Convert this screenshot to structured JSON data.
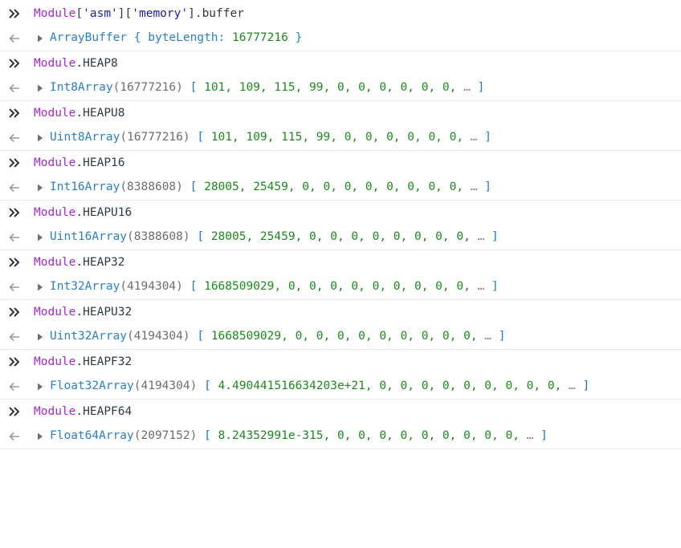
{
  "colors": {
    "module": "#a626d6",
    "string": "#1a1aa6",
    "constructor": "#2a7fc8",
    "length": "#6d6d6d",
    "bracket": "#1a74d1",
    "number": "#1c8a1c",
    "divider": "#e8e8e8"
  },
  "icons": {
    "input_prompt": "double-chevron-right-icon",
    "result_arrow": "arrow-left-icon",
    "expand": "triangle-right-icon"
  },
  "entries": [
    {
      "input": {
        "module": "Module",
        "accessor_open": "[",
        "key1": "'asm'",
        "mid": "][",
        "key2": "'memory'",
        "close": "].",
        "prop": "buffer"
      },
      "output": {
        "ctor": "ArrayBuffer",
        "len": "",
        "body_open": " { ",
        "body_key": "byteLength",
        "body_sep": ": ",
        "body_value": "16777216",
        "body_close": " }"
      }
    },
    {
      "input": {
        "module": "Module",
        "dot": ".",
        "prop": "HEAP8"
      },
      "output": {
        "ctor": "Int8Array",
        "len": "(16777216)",
        "values": "101, 109, 115, 99, 0, 0, 0, 0, 0, 0,"
      }
    },
    {
      "input": {
        "module": "Module",
        "dot": ".",
        "prop": "HEAPU8"
      },
      "output": {
        "ctor": "Uint8Array",
        "len": "(16777216)",
        "values": "101, 109, 115, 99, 0, 0, 0, 0, 0, 0,"
      }
    },
    {
      "input": {
        "module": "Module",
        "dot": ".",
        "prop": "HEAP16"
      },
      "output": {
        "ctor": "Int16Array",
        "len": "(8388608)",
        "values": "28005, 25459, 0, 0, 0, 0, 0, 0, 0, 0,"
      }
    },
    {
      "input": {
        "module": "Module",
        "dot": ".",
        "prop": "HEAPU16"
      },
      "output": {
        "ctor": "Uint16Array",
        "len": "(8388608)",
        "values": "28005, 25459, 0, 0, 0, 0, 0, 0, 0, 0,"
      }
    },
    {
      "input": {
        "module": "Module",
        "dot": ".",
        "prop": "HEAP32"
      },
      "output": {
        "ctor": "Int32Array",
        "len": "(4194304)",
        "values": "1668509029, 0, 0, 0, 0, 0, 0, 0, 0, 0,"
      }
    },
    {
      "input": {
        "module": "Module",
        "dot": ".",
        "prop": "HEAPU32"
      },
      "output": {
        "ctor": "Uint32Array",
        "len": "(4194304)",
        "values": "1668509029, 0, 0, 0, 0, 0, 0, 0, 0, 0,"
      }
    },
    {
      "input": {
        "module": "Module",
        "dot": ".",
        "prop": "HEAPF32"
      },
      "output": {
        "ctor": "Float32Array",
        "len": "(4194304)",
        "values": "4.490441516634203e+21, 0, 0, 0, 0, 0, 0, 0, 0, 0,"
      }
    },
    {
      "input": {
        "module": "Module",
        "dot": ".",
        "prop": "HEAPF64"
      },
      "output": {
        "ctor": "Float64Array",
        "len": "(2097152)",
        "values": "8.24352991e-315, 0, 0, 0, 0, 0, 0, 0, 0, 0,"
      }
    }
  ],
  "array_open": "[ ",
  "ellipsis": "…",
  "array_close": " ]"
}
